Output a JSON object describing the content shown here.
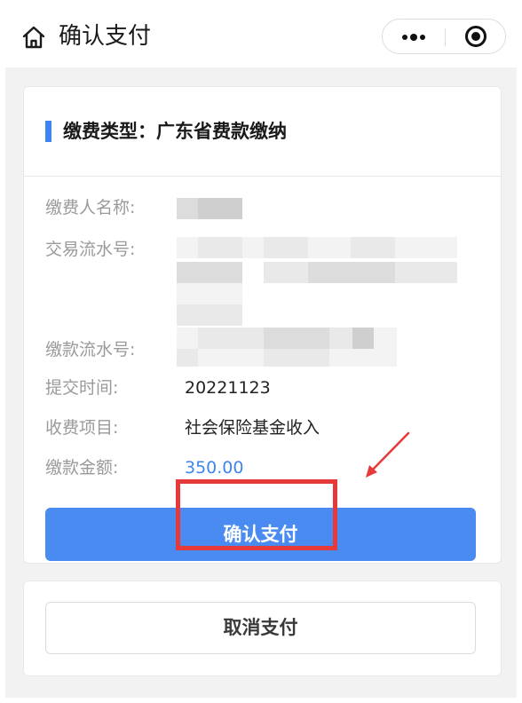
{
  "navbar": {
    "title": "确认支付",
    "home_icon": "home-icon",
    "more_icon": "more-dots-icon",
    "close_icon": "target-circle-icon"
  },
  "card": {
    "header_title": "缴费类型：广东省费款缴纳",
    "fields": [
      {
        "label": "缴费人名称:",
        "value": ""
      },
      {
        "label": "交易流水号:",
        "value": ""
      },
      {
        "label": "缴款流水号:",
        "value": ""
      },
      {
        "label": "提交时间:",
        "value": "20221123"
      },
      {
        "label": "收费项目:",
        "value": "社会保险基金收入"
      },
      {
        "label": "缴款金额:",
        "value": "350.00"
      }
    ],
    "confirm_label": "确认支付"
  },
  "cancel": {
    "label": "取消支付"
  },
  "colors": {
    "accent": "#4a8bf1",
    "amount": "#3d85f0",
    "annotation": "#e63a3a",
    "label": "#9a9a9a",
    "background": "#f2f2f2"
  }
}
